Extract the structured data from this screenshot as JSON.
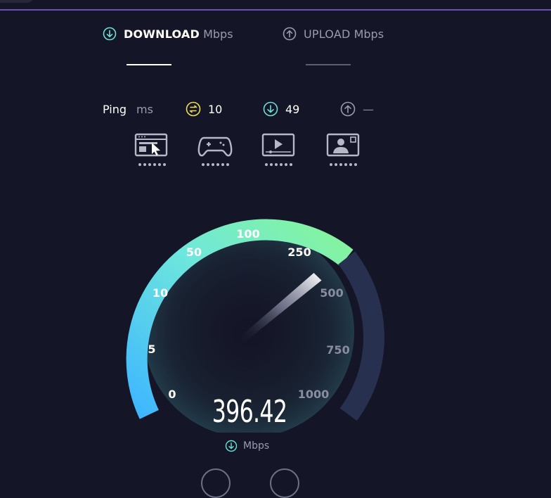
{
  "header": {
    "download_label": "DOWNLOAD",
    "download_unit": "Mbps",
    "upload_label": "UPLOAD",
    "upload_unit": "Mbps"
  },
  "ping": {
    "label": "Ping",
    "unit": "ms",
    "idle": "10",
    "download": "49",
    "upload": "—"
  },
  "app_icons": [
    "browsing-icon",
    "gaming-icon",
    "streaming-icon",
    "video-call-icon"
  ],
  "gauge": {
    "ticks": [
      "0",
      "5",
      "10",
      "50",
      "100",
      "250",
      "500",
      "750",
      "1000"
    ],
    "value": "396.42",
    "unit": "Mbps"
  },
  "colors": {
    "background": "#141526",
    "accent_green": "#86f59a",
    "accent_blue": "#3eb6ff",
    "idle_yellow": "#f2de52",
    "download_teal": "#6ce1d8",
    "track_inactive": "#28304f"
  }
}
